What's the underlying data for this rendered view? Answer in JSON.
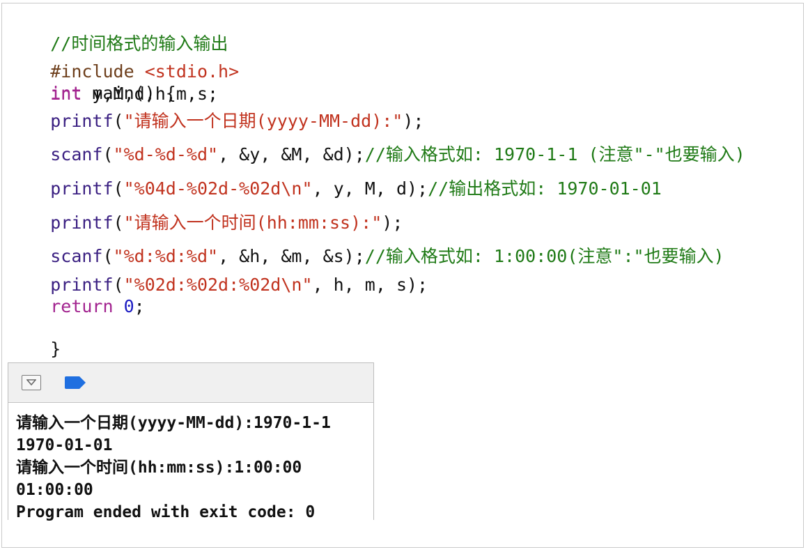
{
  "code": {
    "comment_title": "//时间格式的输入输出",
    "include_directive": "#include",
    "include_path": "<stdio.h>",
    "main_kw": "int",
    "main_sig": " main() {",
    "decl_kw": "int",
    "decl_vars": " y,M,d,h,m,s;",
    "l1_fn": "printf",
    "l1_open": "(",
    "l1_str": "\"请输入一个日期(yyyy-MM-dd):\"",
    "l1_close": ");",
    "l2_fn": "scanf",
    "l2_open": "(",
    "l2_str": "\"%d-%d-%d\"",
    "l2_args": ", &y, &M, &d);",
    "l2_comment": "//输入格式如: 1970-1-1 (注意\"-\"也要输入)",
    "l3_fn": "printf",
    "l3_open": "(",
    "l3_str": "\"%04d-%02d-%02d\\n\"",
    "l3_args": ", y, M, d);",
    "l3_comment": "//输出格式如: 1970-01-01",
    "l4_fn": "printf",
    "l4_open": "(",
    "l4_str": "\"请输入一个时间(hh:mm:ss):\"",
    "l4_close": ");",
    "l5_fn": "scanf",
    "l5_open": "(",
    "l5_str": "\"%d:%d:%d\"",
    "l5_args": ", &h, &m, &s);",
    "l5_comment": "//输入格式如: 1:00:00(注意\":\"也要输入)",
    "l6_fn": "printf",
    "l6_open": "(",
    "l6_str": "\"%02d:%02d:%02d\\n\"",
    "l6_args": ", h, m, s);",
    "ret_kw": "return",
    "ret_num": "0",
    "ret_end": ";",
    "close_brace": "}"
  },
  "console": {
    "hide_icon": "hide-console-icon",
    "breakpoint_icon": "breakpoint-tag-icon",
    "output": [
      "请输入一个日期(yyyy-MM-dd):1970-1-1",
      "1970-01-01",
      "请输入一个时间(hh:mm:ss):1:00:00",
      "01:00:00",
      "Program ended with exit code: 0"
    ]
  },
  "colors": {
    "comment": "#1f7a16",
    "keyword": "#a2238f",
    "function": "#3b2082",
    "string": "#c1331f",
    "number": "#1a1ac2",
    "breakpoint": "#1f6fe0"
  }
}
